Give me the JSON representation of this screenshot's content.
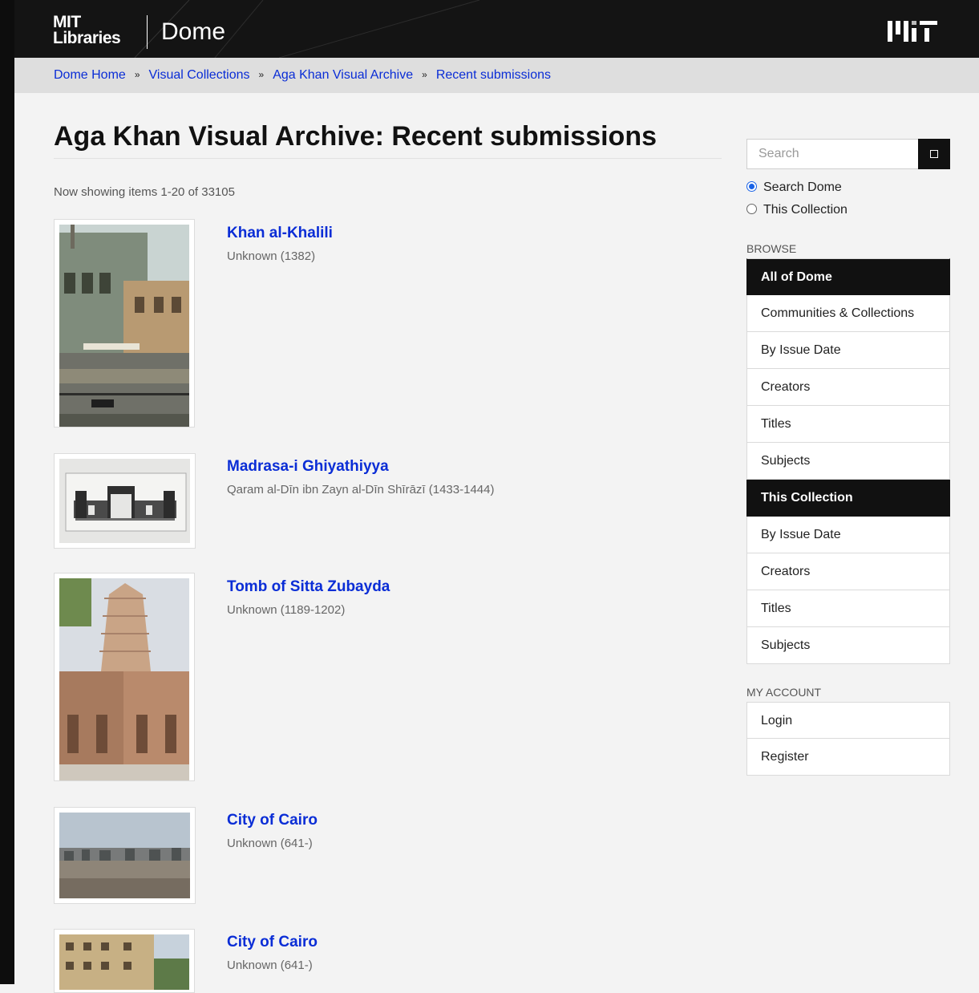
{
  "header": {
    "logo_line1": "MIT",
    "logo_line2": "Libraries",
    "app_title": "Dome"
  },
  "breadcrumb": [
    {
      "label": "Dome Home"
    },
    {
      "label": "Visual Collections"
    },
    {
      "label": "Aga Khan Visual Archive"
    },
    {
      "label": "Recent submissions"
    }
  ],
  "breadcrumb_separator": "»",
  "main": {
    "title": "Aga Khan Visual Archive: Recent submissions",
    "showing_text": "Now showing items 1-20 of 33105",
    "items": [
      {
        "title": "Khan al-Khalili",
        "meta": "Unknown (1382)",
        "thumb": "street-scene-photo"
      },
      {
        "title": "Madrasa-i Ghiyathiyya",
        "meta": "Qaram al-Dīn ibn Zayn al-Dīn Shīrāzī (1433-1444)",
        "thumb": "architectural-elevation-drawing"
      },
      {
        "title": "Tomb of Sitta Zubayda",
        "meta": "Unknown (1189-1202)",
        "thumb": "conical-tomb-photo"
      },
      {
        "title": "City of Cairo",
        "meta": "Unknown (641-)",
        "thumb": "city-skyline-photo"
      },
      {
        "title": "City of Cairo",
        "meta": "Unknown (641-)",
        "thumb": "apartment-building-photo"
      }
    ]
  },
  "sidebar": {
    "search_placeholder": "Search",
    "scope_options": [
      {
        "label": "Search Dome",
        "checked": true
      },
      {
        "label": "This Collection",
        "checked": false
      }
    ],
    "browse_heading": "BROWSE",
    "browse_all": {
      "header": "All of Dome",
      "items": [
        "Communities & Collections",
        "By Issue Date",
        "Creators",
        "Titles",
        "Subjects"
      ]
    },
    "browse_collection": {
      "header": "This Collection",
      "items": [
        "By Issue Date",
        "Creators",
        "Titles",
        "Subjects"
      ]
    },
    "account_heading": "MY ACCOUNT",
    "account_items": [
      "Login",
      "Register"
    ]
  },
  "colors": {
    "link": "#0a2dd6",
    "header_bg": "#141414",
    "accent_radio": "#1a63e6"
  }
}
